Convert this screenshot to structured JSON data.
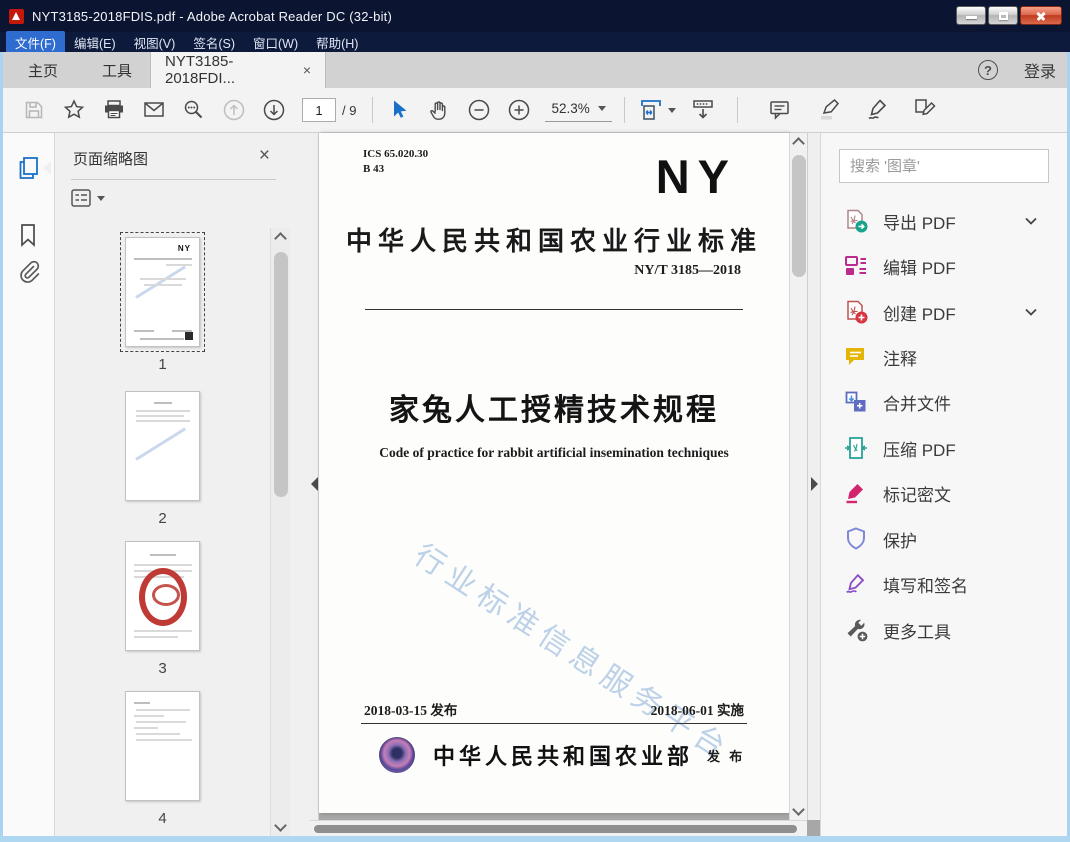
{
  "window": {
    "title": "NYT3185-2018FDIS.pdf - Adobe Acrobat Reader DC (32-bit)"
  },
  "menu": {
    "items": [
      {
        "label": "文件(F)"
      },
      {
        "label": "编辑(E)"
      },
      {
        "label": "视图(V)"
      },
      {
        "label": "签名(S)"
      },
      {
        "label": "窗口(W)"
      },
      {
        "label": "帮助(H)"
      }
    ]
  },
  "tabs": {
    "home": "主页",
    "tools": "工具",
    "document": "NYT3185-2018FDI...",
    "close_glyph": "×",
    "help_glyph": "?",
    "sign_in": "登录"
  },
  "toolbar": {
    "page_current": "1",
    "page_total": "/ 9",
    "zoom_value": "52.3%"
  },
  "left_panel": {
    "title": "页面缩略图",
    "close_glyph": "×",
    "pages": [
      {
        "number": "1"
      },
      {
        "number": "2"
      },
      {
        "number": "3"
      },
      {
        "number": "4"
      }
    ]
  },
  "document": {
    "ics_line1": "ICS 65.020.30",
    "ics_line2": "B 43",
    "logo": "NY",
    "standard_type": "中华人民共和国农业行业标准",
    "standard_number": "NY/T 3185—2018",
    "title_cn": "家兔人工授精技术规程",
    "title_en": "Code of practice for rabbit artificial insemination techniques",
    "watermark": "行业标准信息服务平台",
    "issue_date": "2018-03-15 发布",
    "implement_date": "2018-06-01 实施",
    "publisher": "中华人民共和国农业部",
    "publish_label": "发 布"
  },
  "right_panel": {
    "search_placeholder": "搜索 '图章'",
    "tools": [
      {
        "label": "导出 PDF",
        "icon": "export-pdf-icon",
        "color": "#1aa38c",
        "has_chevron": true
      },
      {
        "label": "编辑 PDF",
        "icon": "edit-pdf-icon",
        "color": "#bc2a8d",
        "has_chevron": false
      },
      {
        "label": "创建 PDF",
        "icon": "create-pdf-icon",
        "color": "#d6363f",
        "has_chevron": true
      },
      {
        "label": "注释",
        "icon": "comment-icon",
        "color": "#e3b505",
        "has_chevron": false
      },
      {
        "label": "合并文件",
        "icon": "combine-files-icon",
        "color": "#5f6cc0",
        "has_chevron": false
      },
      {
        "label": "压缩 PDF",
        "icon": "compress-pdf-icon",
        "color": "#27a295",
        "has_chevron": false
      },
      {
        "label": "标记密文",
        "icon": "redact-icon",
        "color": "#d2256e",
        "has_chevron": false
      },
      {
        "label": "保护",
        "icon": "protect-icon",
        "color": "#8089d8",
        "has_chevron": false
      },
      {
        "label": "填写和签名",
        "icon": "fill-sign-icon",
        "color": "#8a4fc8",
        "has_chevron": false
      },
      {
        "label": "更多工具",
        "icon": "more-tools-icon",
        "color": "#5a5a5a",
        "has_chevron": false
      }
    ]
  },
  "colors": {
    "titlebar": "#0b1531",
    "menu_highlight": "#2f6cd0",
    "accent_blue": "#1a70c8",
    "doc_background": "#a7a7a7",
    "watermark": "#b9cfe7",
    "window_border": "#a9d3f0"
  }
}
